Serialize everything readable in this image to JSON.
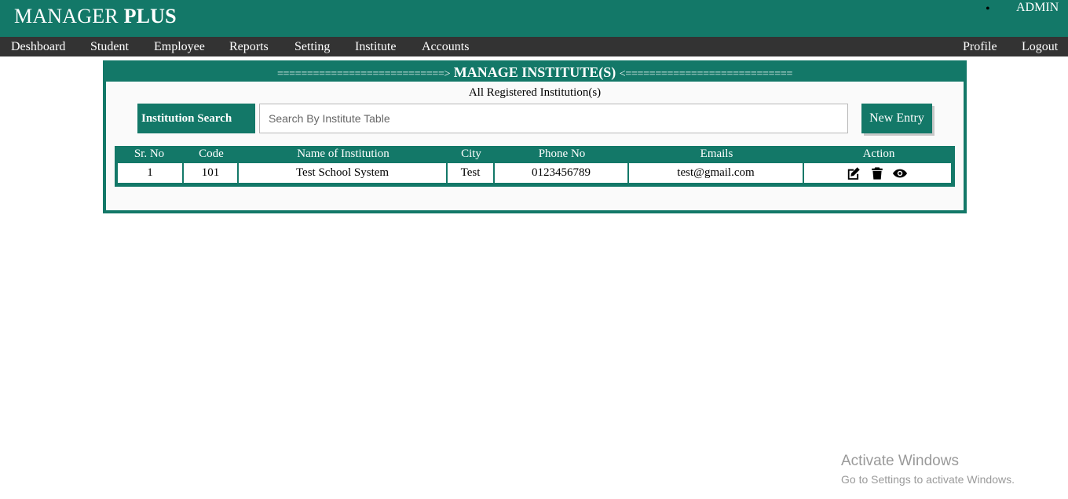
{
  "header": {
    "brand_main": "MANAGER ",
    "brand_bold": "PLUS",
    "user": "ADMIN"
  },
  "nav": {
    "left": [
      "Deshboard",
      "Student",
      "Employee",
      "Reports",
      "Setting",
      "Institute",
      "Accounts"
    ],
    "right": [
      "Profile",
      "Logout"
    ]
  },
  "panel": {
    "arrow_left": "============================>",
    "title": "MANAGE INSTITUTE(S)",
    "arrow_right": "<============================",
    "subtitle": "All Registered Institution(s)"
  },
  "search": {
    "label": "Institution Search",
    "placeholder": "Search By Institute Table",
    "value": ""
  },
  "new_entry_label": "New Entry",
  "table": {
    "columns": [
      "Sr. No",
      "Code",
      "Name of Institution",
      "City",
      "Phone No",
      "Emails",
      "Action"
    ],
    "rows": [
      {
        "sr_no": "1",
        "code": "101",
        "name": "Test School System",
        "city": "Test",
        "phone": "0123456789",
        "email": "test@gmail.com",
        "actions": [
          "edit-icon",
          "trash-icon",
          "eye-icon"
        ]
      }
    ]
  },
  "watermark": {
    "line1": "Activate Windows",
    "line2": "Go to Settings to activate Windows."
  },
  "colors": {
    "primary": "#137868",
    "navbar": "#333333"
  }
}
